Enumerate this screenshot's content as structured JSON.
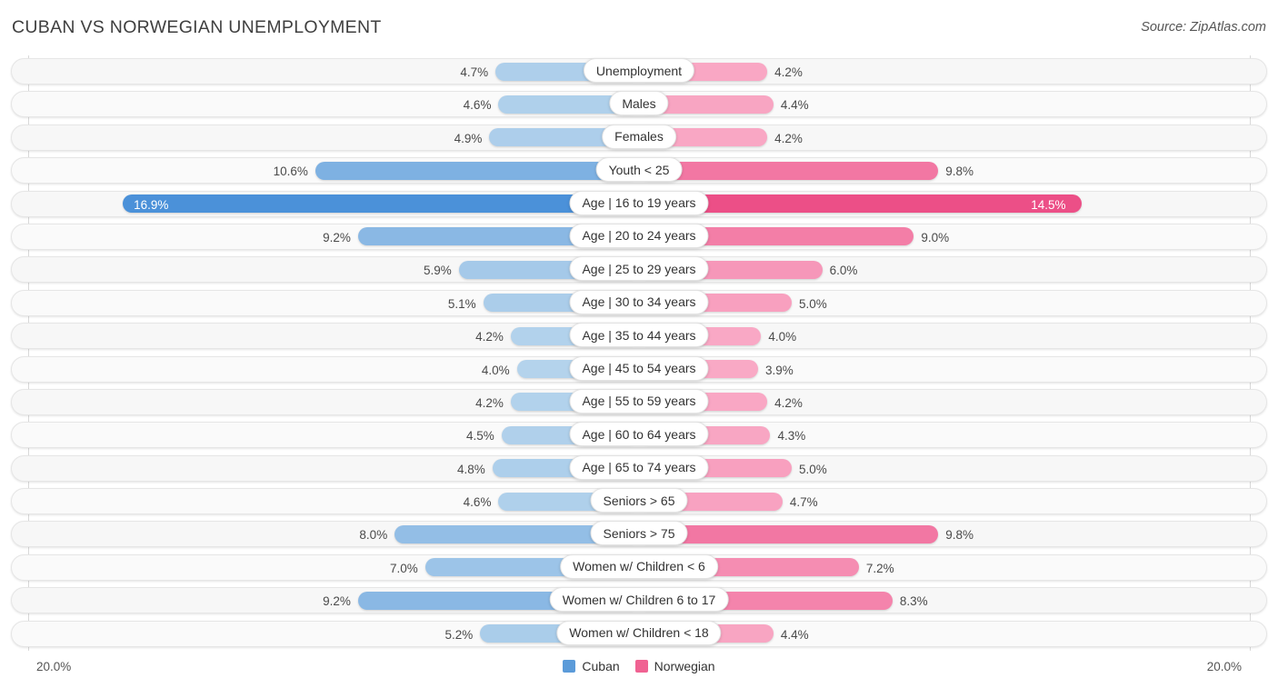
{
  "header": {
    "title": "CUBAN VS NORWEGIAN UNEMPLOYMENT",
    "source": "Source: ZipAtlas.com"
  },
  "footer": {
    "axis_left": "20.0%",
    "axis_right": "20.0%",
    "legend": [
      {
        "label": "Cuban",
        "color": "#5b9bd9"
      },
      {
        "label": "Norwegian",
        "color": "#f06292"
      }
    ]
  },
  "chart_data": {
    "type": "bar",
    "title": "CUBAN VS NORWEGIAN UNEMPLOYMENT",
    "subtitle": "Source: ZipAtlas.com",
    "orientation": "horizontal-diverging",
    "xlabel": "",
    "ylabel": "",
    "xlim": [
      0,
      20
    ],
    "axis_max": 20.0,
    "axis_min_label": "20.0%",
    "axis_max_label": "20.0%",
    "grid": false,
    "legend_position": "bottom-center",
    "categories": [
      "Unemployment",
      "Males",
      "Females",
      "Youth < 25",
      "Age | 16 to 19 years",
      "Age | 20 to 24 years",
      "Age | 25 to 29 years",
      "Age | 30 to 34 years",
      "Age | 35 to 44 years",
      "Age | 45 to 54 years",
      "Age | 55 to 59 years",
      "Age | 60 to 64 years",
      "Age | 65 to 74 years",
      "Seniors > 65",
      "Seniors > 75",
      "Women w/ Children < 6",
      "Women w/ Children 6 to 17",
      "Women w/ Children < 18"
    ],
    "series": [
      {
        "name": "Cuban",
        "color": "#5b9bd9",
        "side": "left",
        "values": [
          4.7,
          4.6,
          4.9,
          10.6,
          16.9,
          9.2,
          5.9,
          5.1,
          4.2,
          4.0,
          4.2,
          4.5,
          4.8,
          4.6,
          8.0,
          7.0,
          9.2,
          5.2
        ],
        "labels": [
          "4.7%",
          "4.6%",
          "4.9%",
          "10.6%",
          "16.9%",
          "9.2%",
          "5.9%",
          "5.1%",
          "4.2%",
          "4.0%",
          "4.2%",
          "4.5%",
          "4.8%",
          "4.6%",
          "8.0%",
          "7.0%",
          "9.2%",
          "5.2%"
        ]
      },
      {
        "name": "Norwegian",
        "color": "#f06292",
        "side": "right",
        "values": [
          4.2,
          4.4,
          4.2,
          9.8,
          14.5,
          9.0,
          6.0,
          5.0,
          4.0,
          3.9,
          4.2,
          4.3,
          5.0,
          4.7,
          9.8,
          7.2,
          8.3,
          4.4
        ],
        "labels": [
          "4.2%",
          "4.4%",
          "4.2%",
          "9.8%",
          "14.5%",
          "9.0%",
          "6.0%",
          "5.0%",
          "4.0%",
          "3.9%",
          "4.2%",
          "4.3%",
          "5.0%",
          "4.7%",
          "9.8%",
          "7.2%",
          "8.3%",
          "4.4%"
        ]
      }
    ]
  }
}
